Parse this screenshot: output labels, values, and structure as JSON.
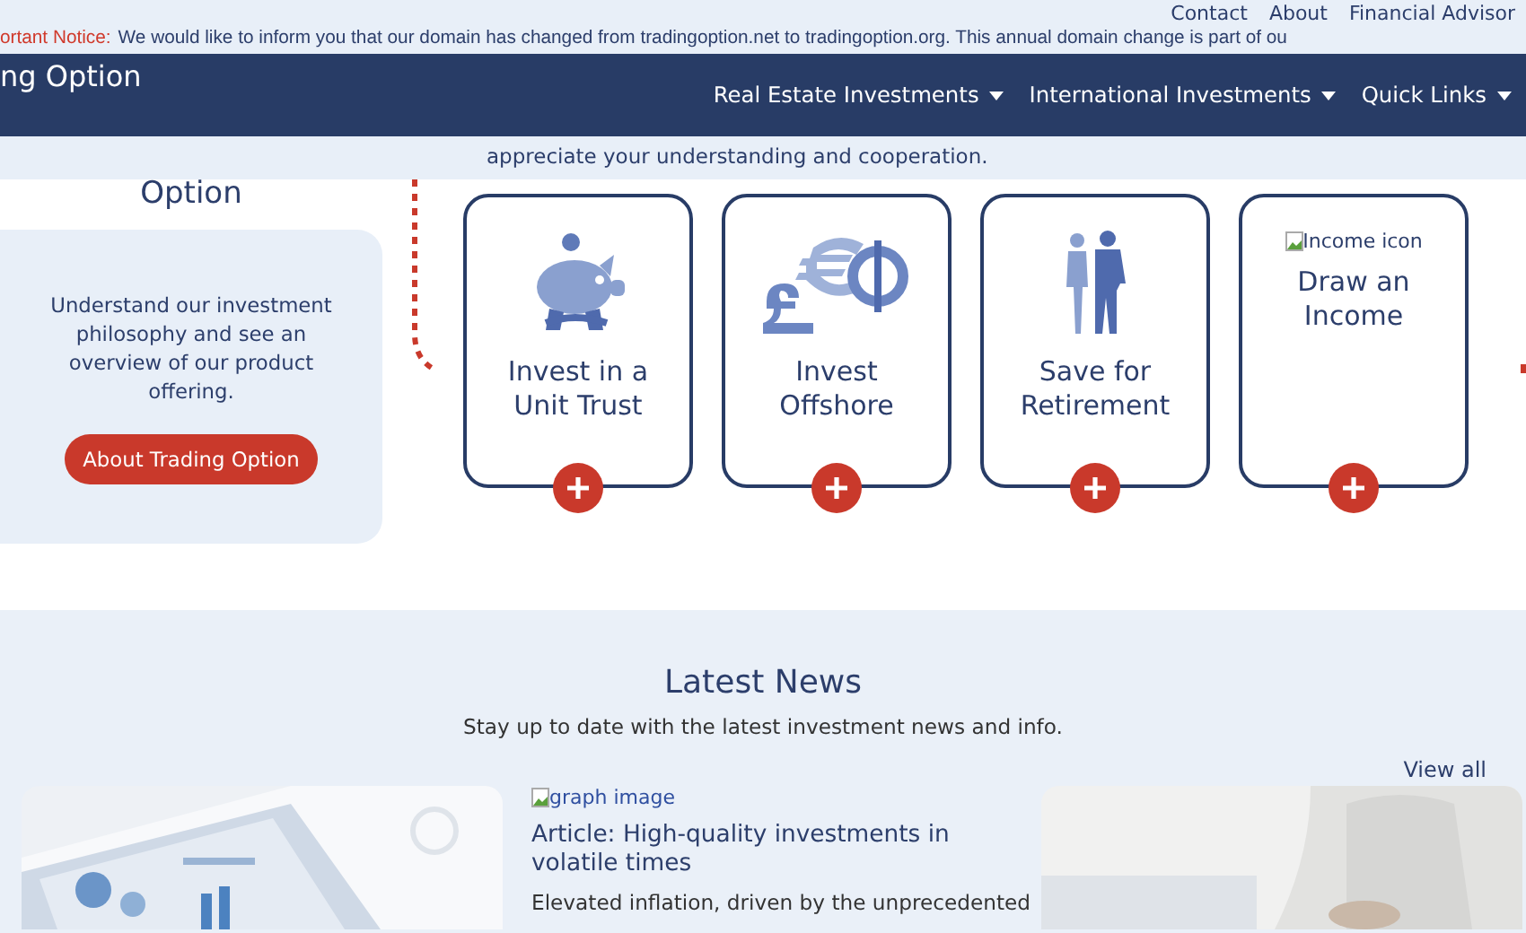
{
  "notice": {
    "label": "ortant Notice:",
    "text": "We would like to inform you that our domain has changed from tradingoption.net to tradingoption.org. This annual domain change is part of ou",
    "tail": "appreciate your understanding and cooperation."
  },
  "top_links": [
    "Contact",
    "About",
    "Financial Advisor"
  ],
  "brand": "ng Option",
  "nav": [
    {
      "label": "Real Estate Investments"
    },
    {
      "label": "International Investments"
    },
    {
      "label": "Quick Links"
    }
  ],
  "intro": {
    "heading": "Option",
    "text": "Understand our investment philosophy and see an overview of our product offering.",
    "button": "About Trading Option"
  },
  "products": [
    {
      "kind": "piggy-bank",
      "title": "Invest in a Unit Trust"
    },
    {
      "kind": "currency",
      "title": "Invest Offshore"
    },
    {
      "kind": "couple",
      "title": "Save for Retirement"
    },
    {
      "kind": "broken-image",
      "alt": "Income icon",
      "title": "Draw an Income"
    }
  ],
  "news": {
    "title": "Latest News",
    "subtitle": "Stay up to date with the latest investment news and info.",
    "view_all": "View all",
    "articles": [
      {
        "kind": "picture"
      },
      {
        "kind": "text",
        "image_alt": "graph image",
        "title": "Article: High-quality investments in volatile times",
        "excerpt": "Elevated inflation, driven by the unprecedented"
      },
      {
        "kind": "picture"
      }
    ]
  }
}
